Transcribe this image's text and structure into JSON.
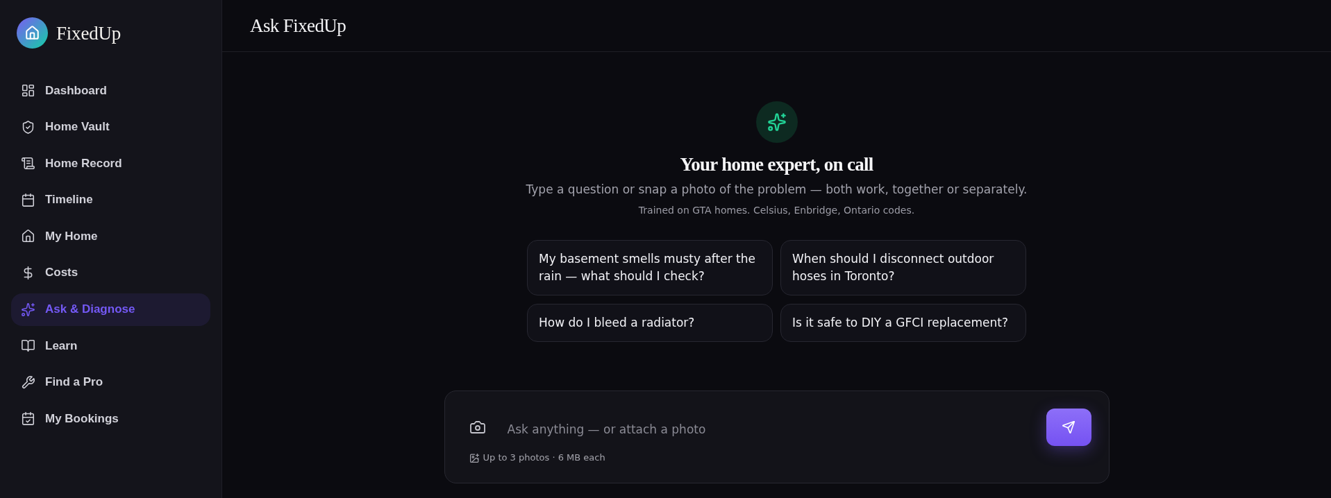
{
  "sidebar": {
    "brand": "FixedUp",
    "items": [
      {
        "label": "Dashboard",
        "selected": false
      },
      {
        "label": "Home Vault",
        "selected": false
      },
      {
        "label": "Home Record",
        "selected": false
      },
      {
        "label": "Timeline",
        "selected": false
      },
      {
        "label": "My Home",
        "selected": false
      },
      {
        "label": "Costs",
        "selected": false
      },
      {
        "label": "Ask & Diagnose",
        "selected": true
      },
      {
        "label": "Learn",
        "selected": false
      },
      {
        "label": "Find a Pro",
        "selected": false
      },
      {
        "label": "My Bookings",
        "selected": false
      }
    ]
  },
  "header": {
    "title": "Ask FixedUp"
  },
  "hero": {
    "title": "Your home expert, on call",
    "subtitle": "Type a question or snap a photo of the problem — both work, together or separately.",
    "note": "Trained on GTA homes. Celsius, Enbridge, Ontario codes."
  },
  "suggestions": [
    "My basement smells musty after the rain — what should I check?",
    "When should I disconnect outdoor hoses in Toronto?",
    "How do I bleed a radiator?",
    "Is it safe to DIY a GFCI replacement?"
  ],
  "composer": {
    "placeholder": "Ask anything — or attach a photo",
    "hint": "Up to 3 photos · 6 MB each"
  }
}
